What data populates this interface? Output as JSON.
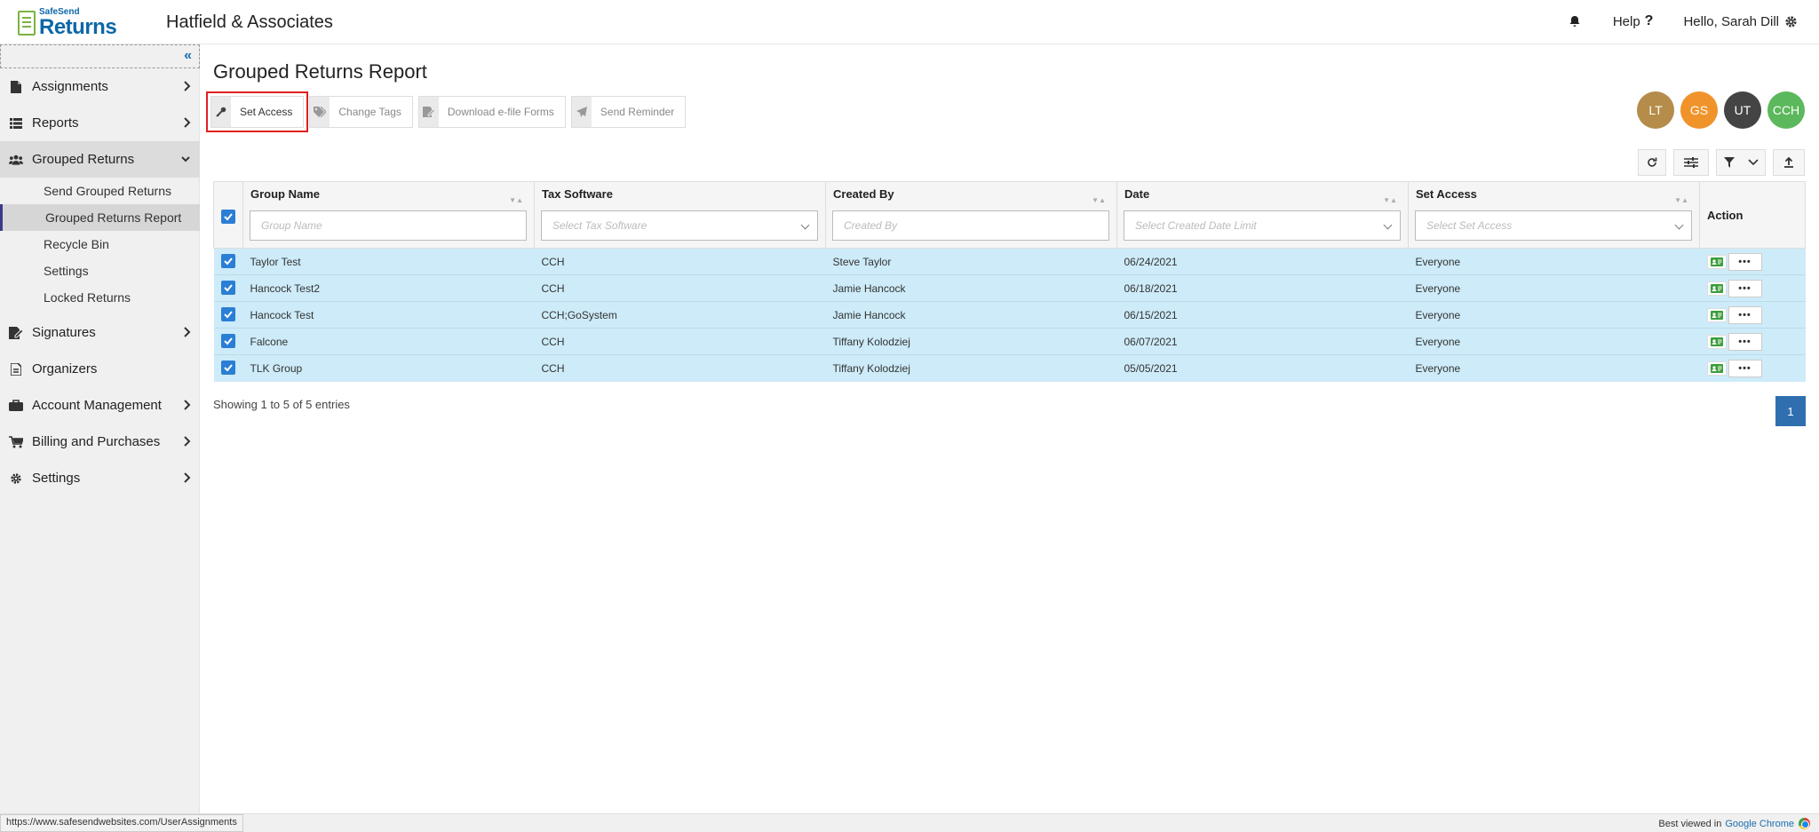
{
  "header": {
    "logo_small": "SafeSend",
    "logo_big": "Returns",
    "firm_name": "Hatfield & Associates",
    "help_label": "Help",
    "help_mark": "?",
    "greeting": "Hello, Sarah Dill"
  },
  "sidebar": {
    "collapse_glyph": "«",
    "items": [
      {
        "label": "Assignments",
        "icon": "file-icon"
      },
      {
        "label": "Reports",
        "icon": "list-icon"
      },
      {
        "label": "Grouped Returns",
        "icon": "users-icon"
      },
      {
        "label": "Signatures",
        "icon": "signature-icon"
      },
      {
        "label": "Organizers",
        "icon": "document-icon"
      },
      {
        "label": "Account Management",
        "icon": "briefcase-icon"
      },
      {
        "label": "Billing and Purchases",
        "icon": "cart-icon"
      },
      {
        "label": "Settings",
        "icon": "gear-icon"
      }
    ],
    "sub_items": [
      {
        "label": "Send Grouped Returns"
      },
      {
        "label": "Grouped Returns Report"
      },
      {
        "label": "Recycle Bin"
      },
      {
        "label": "Settings"
      },
      {
        "label": "Locked Returns"
      }
    ]
  },
  "page": {
    "title": "Grouped Returns Report"
  },
  "toolbar": {
    "set_access": "Set Access",
    "change_tags": "Change Tags",
    "download_forms": "Download e-file Forms",
    "send_reminder": "Send Reminder"
  },
  "avatars": [
    {
      "initials": "LT",
      "color": "#b58c4a"
    },
    {
      "initials": "GS",
      "color": "#f0932b"
    },
    {
      "initials": "UT",
      "color": "#444444"
    },
    {
      "initials": "CCH",
      "color": "#5cb85c"
    }
  ],
  "table": {
    "columns": [
      {
        "label": "Group Name",
        "placeholder": "Group Name"
      },
      {
        "label": "Tax Software",
        "placeholder": "Select Tax Software"
      },
      {
        "label": "Created By",
        "placeholder": "Created By"
      },
      {
        "label": "Date",
        "placeholder": "Select Created Date Limit"
      },
      {
        "label": "Set Access",
        "placeholder": "Select Set Access"
      },
      {
        "label": "Action"
      }
    ],
    "action_more": "•••",
    "rows": [
      {
        "group": "Taylor Test",
        "software": "CCH",
        "created_by": "Steve Taylor",
        "date": "06/24/2021",
        "access": "Everyone"
      },
      {
        "group": "Hancock Test2",
        "software": "CCH",
        "created_by": "Jamie Hancock",
        "date": "06/18/2021",
        "access": "Everyone"
      },
      {
        "group": "Hancock Test",
        "software": "CCH;GoSystem",
        "created_by": "Jamie Hancock",
        "date": "06/15/2021",
        "access": "Everyone"
      },
      {
        "group": "Falcone",
        "software": "CCH",
        "created_by": "Tiffany Kolodziej",
        "date": "06/07/2021",
        "access": "Everyone"
      },
      {
        "group": "TLK Group",
        "software": "CCH",
        "created_by": "Tiffany Kolodziej",
        "date": "05/05/2021",
        "access": "Everyone"
      }
    ]
  },
  "pagination": {
    "summary": "Showing 1 to 5 of 5 entries",
    "current_page": "1"
  },
  "footer": {
    "status_url": "https://www.safesendwebsites.com/UserAssignments",
    "best_viewed": "Best viewed in",
    "browser": "Google Chrome"
  },
  "colors": {
    "brand": "#0b67a8",
    "row_selected": "#cdebf8",
    "highlight": "#e02020",
    "page_active": "#2f6fb0"
  }
}
